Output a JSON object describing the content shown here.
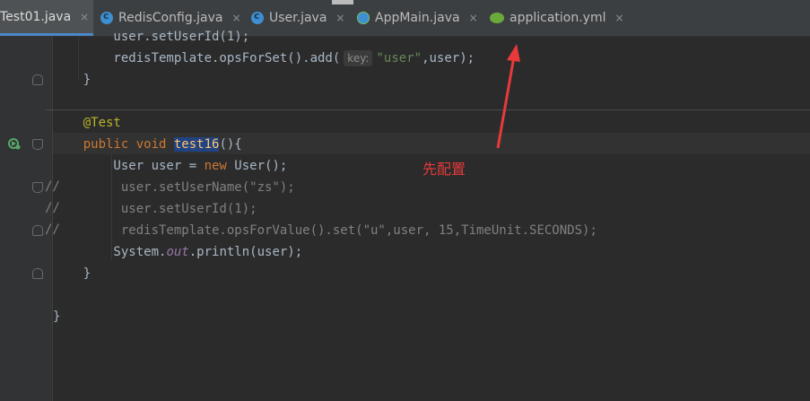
{
  "tabs": [
    {
      "name": "Test01.java",
      "icon": "java-file-icon",
      "active": true
    },
    {
      "name": "RedisConfig.java",
      "icon": "java-class-icon"
    },
    {
      "name": "User.java",
      "icon": "java-class-icon"
    },
    {
      "name": "AppMain.java",
      "icon": "spring-app-icon"
    },
    {
      "name": "application.yml",
      "icon": "spring-yml-icon"
    }
  ],
  "close_glyph": "×",
  "code": {
    "hint_key": "key:"
  },
  "gutter_comment": "//",
  "annotation": {
    "text": "先配置",
    "color": "#e83a3a"
  },
  "colors": {
    "background": "#2b2b2b",
    "keyword": "#cc7832",
    "string": "#6a8759",
    "method": "#ffc66d",
    "annotation": "#bbb529",
    "comment": "#808080",
    "selection": "#214283"
  }
}
